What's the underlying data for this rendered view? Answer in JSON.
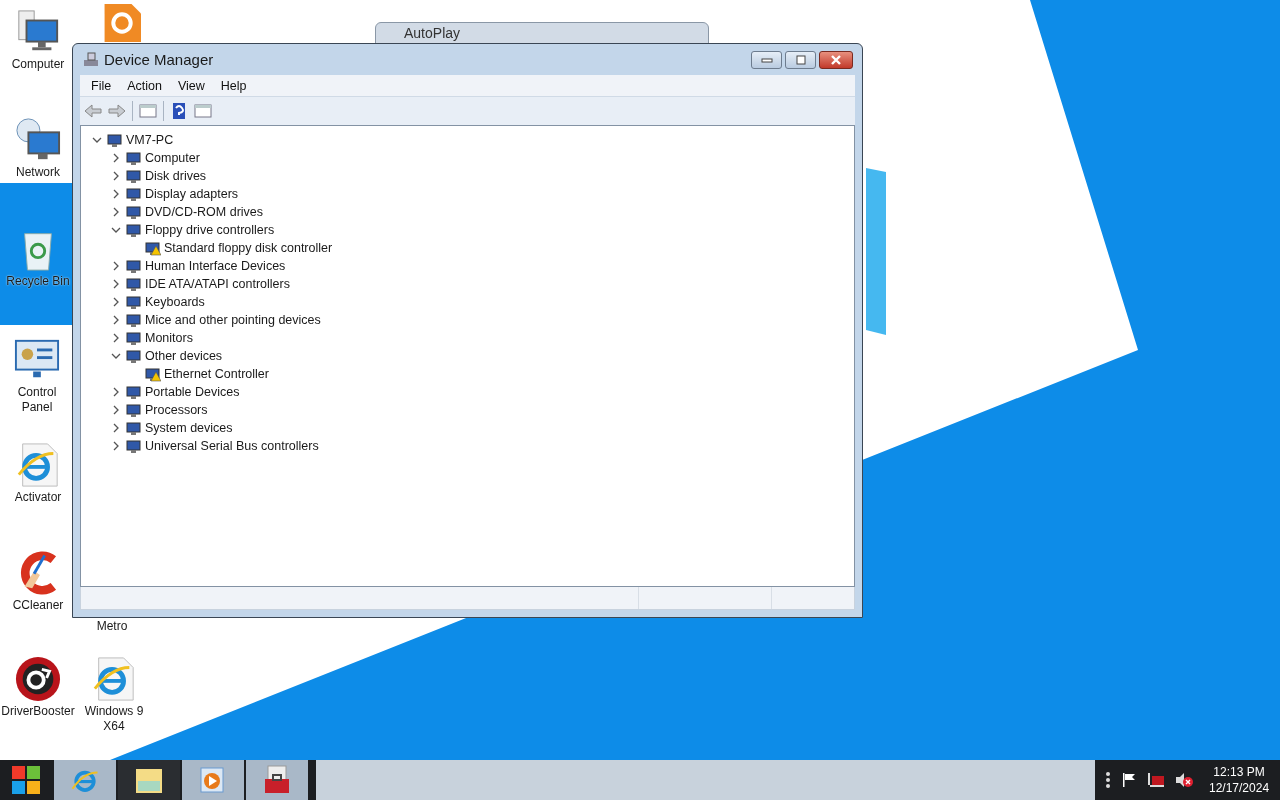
{
  "desktop_icons": [
    {
      "kind": "computer",
      "label": "Computer"
    },
    {
      "kind": "document"
    },
    {
      "kind": "network",
      "label": "Network"
    },
    {
      "kind": "recycle",
      "label": "Recycle Bin"
    },
    {
      "kind": "control",
      "label": "Control Panel"
    },
    {
      "kind": "browser",
      "label": "Activator"
    },
    {
      "kind": "cleaner",
      "label": "CCleaner"
    },
    {
      "kind": "hidden",
      "label": "Metro"
    },
    {
      "kind": "booster",
      "label": "DriverBooster"
    },
    {
      "kind": "browser",
      "label": "Windows 9 X64"
    }
  ],
  "background_window": {
    "title": "AutoPlay"
  },
  "window": {
    "title": "Device Manager",
    "menu": [
      "File",
      "Action",
      "View",
      "Help"
    ],
    "tree": {
      "label": "VM7-PC",
      "expanded": true,
      "children": [
        {
          "label": "Computer",
          "expanded": false,
          "warning": false
        },
        {
          "label": "Disk drives",
          "expanded": false,
          "warning": false
        },
        {
          "label": "Display adapters",
          "expanded": false,
          "warning": false
        },
        {
          "label": "DVD/CD-ROM drives",
          "expanded": false,
          "warning": false
        },
        {
          "label": "Floppy drive controllers",
          "expanded": true,
          "warning": false,
          "children": [
            {
              "label": "Standard floppy disk controller",
              "warning": true
            }
          ]
        },
        {
          "label": "Human Interface Devices",
          "expanded": false,
          "warning": false
        },
        {
          "label": "IDE ATA/ATAPI controllers",
          "expanded": false,
          "warning": false
        },
        {
          "label": "Keyboards",
          "expanded": false,
          "warning": false
        },
        {
          "label": "Mice and other pointing devices",
          "expanded": false,
          "warning": false
        },
        {
          "label": "Monitors",
          "expanded": false,
          "warning": false
        },
        {
          "label": "Other devices",
          "expanded": true,
          "warning": false,
          "children": [
            {
              "label": "Ethernet Controller",
              "warning": true
            }
          ]
        },
        {
          "label": "Portable Devices",
          "expanded": false,
          "warning": false
        },
        {
          "label": "Processors",
          "expanded": false,
          "warning": false
        },
        {
          "label": "System devices",
          "expanded": false,
          "warning": false
        },
        {
          "label": "Universal Serial Bus controllers",
          "expanded": false,
          "warning": false
        }
      ]
    }
  },
  "taskbar": {
    "items": [
      {
        "kind": "browser",
        "open": true
      },
      {
        "kind": "folder",
        "open": false
      },
      {
        "kind": "media",
        "open": true
      },
      {
        "kind": "toolbox",
        "open": true
      }
    ],
    "clock": {
      "time": "12:13 PM",
      "date": "12/17/2024"
    }
  }
}
